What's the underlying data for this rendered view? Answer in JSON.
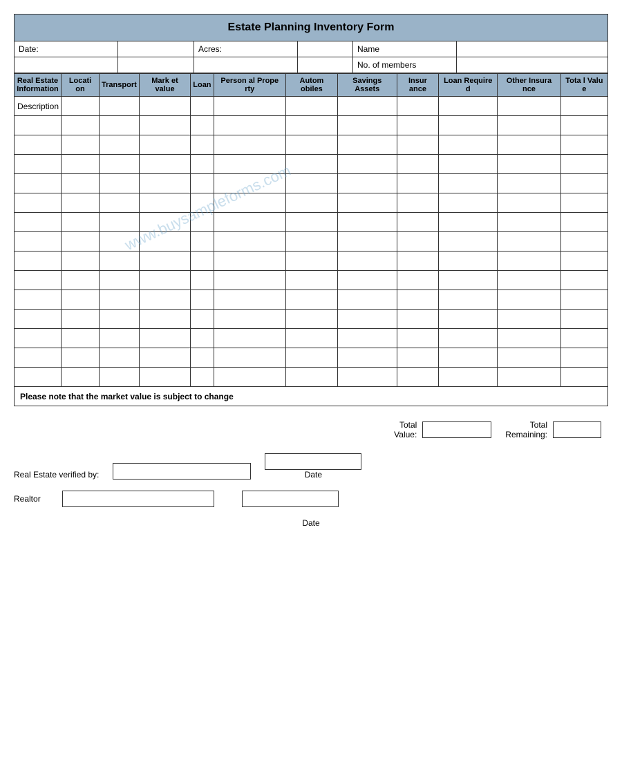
{
  "title": "Estate Planning Inventory Form",
  "header": {
    "date_label": "Date:",
    "acres_label": "Acres:",
    "name_label": "Name",
    "no_of_members_label": "No. of members"
  },
  "columns": [
    {
      "id": "real_estate",
      "label": "Real Estate Information"
    },
    {
      "id": "location",
      "label": "Location"
    },
    {
      "id": "transport",
      "label": "Transport"
    },
    {
      "id": "market_value",
      "label": "Market value"
    },
    {
      "id": "loan",
      "label": "Loan"
    },
    {
      "id": "personal_property",
      "label": "Personal Property"
    },
    {
      "id": "automobiles",
      "label": "Automobiles"
    },
    {
      "id": "savings_assets",
      "label": "Savings Assets"
    },
    {
      "id": "insurance",
      "label": "Insurance"
    },
    {
      "id": "loan_required",
      "label": "Loan Required"
    },
    {
      "id": "other_insurance",
      "label": "Other Insurance"
    },
    {
      "id": "total_value",
      "label": "Total Value"
    }
  ],
  "description_label": "Description",
  "data_rows": 14,
  "note": "Please note that the market value is subject to change",
  "bottom": {
    "total_value_label": "Total\nValue:",
    "total_remaining_label": "Total\nRemaining:",
    "real_estate_verified_label": "Real Estate verified by:",
    "date_label": "Date",
    "realtor_label": "Realtor",
    "date_bottom_label": "Date"
  },
  "watermark": "www.buysampleforms.com"
}
